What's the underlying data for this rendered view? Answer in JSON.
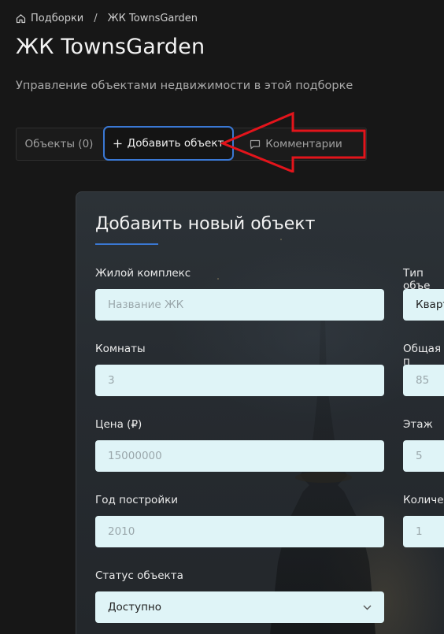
{
  "breadcrumb": {
    "root": "Подборки",
    "separator": "/",
    "current": "ЖК TownsGarden"
  },
  "page": {
    "title": "ЖК TownsGarden",
    "subtitle": "Управление объектами недвижимости в этой подборке"
  },
  "tabs": {
    "objects": "Объекты (0)",
    "add": "Добавить объект",
    "comments": "Комментарии"
  },
  "form": {
    "title": "Добавить новый объект",
    "complex": {
      "label": "Жилой комплекс",
      "placeholder": "Название ЖК"
    },
    "type": {
      "label": "Тип объе",
      "value": "Кварт"
    },
    "rooms": {
      "label": "Комнаты",
      "placeholder": "3"
    },
    "area": {
      "label": "Общая п",
      "placeholder": "85"
    },
    "price": {
      "label": "Цена (₽)",
      "placeholder": "15000000"
    },
    "floor": {
      "label": "Этаж",
      "placeholder": "5"
    },
    "year": {
      "label": "Год постройки",
      "placeholder": "2010"
    },
    "count": {
      "label": "Количес",
      "placeholder": "1"
    },
    "status": {
      "label": "Статус объекта",
      "value": "Доступно"
    }
  },
  "colors": {
    "accent": "#3a78d4",
    "annotation_arrow": "#e3141b",
    "input_bg": "#dff4f7"
  },
  "icons": {
    "breadcrumb_home": "home-icon",
    "add": "plus-icon",
    "comments": "chat-bubble-icon",
    "select": "chevron-down-icon"
  }
}
